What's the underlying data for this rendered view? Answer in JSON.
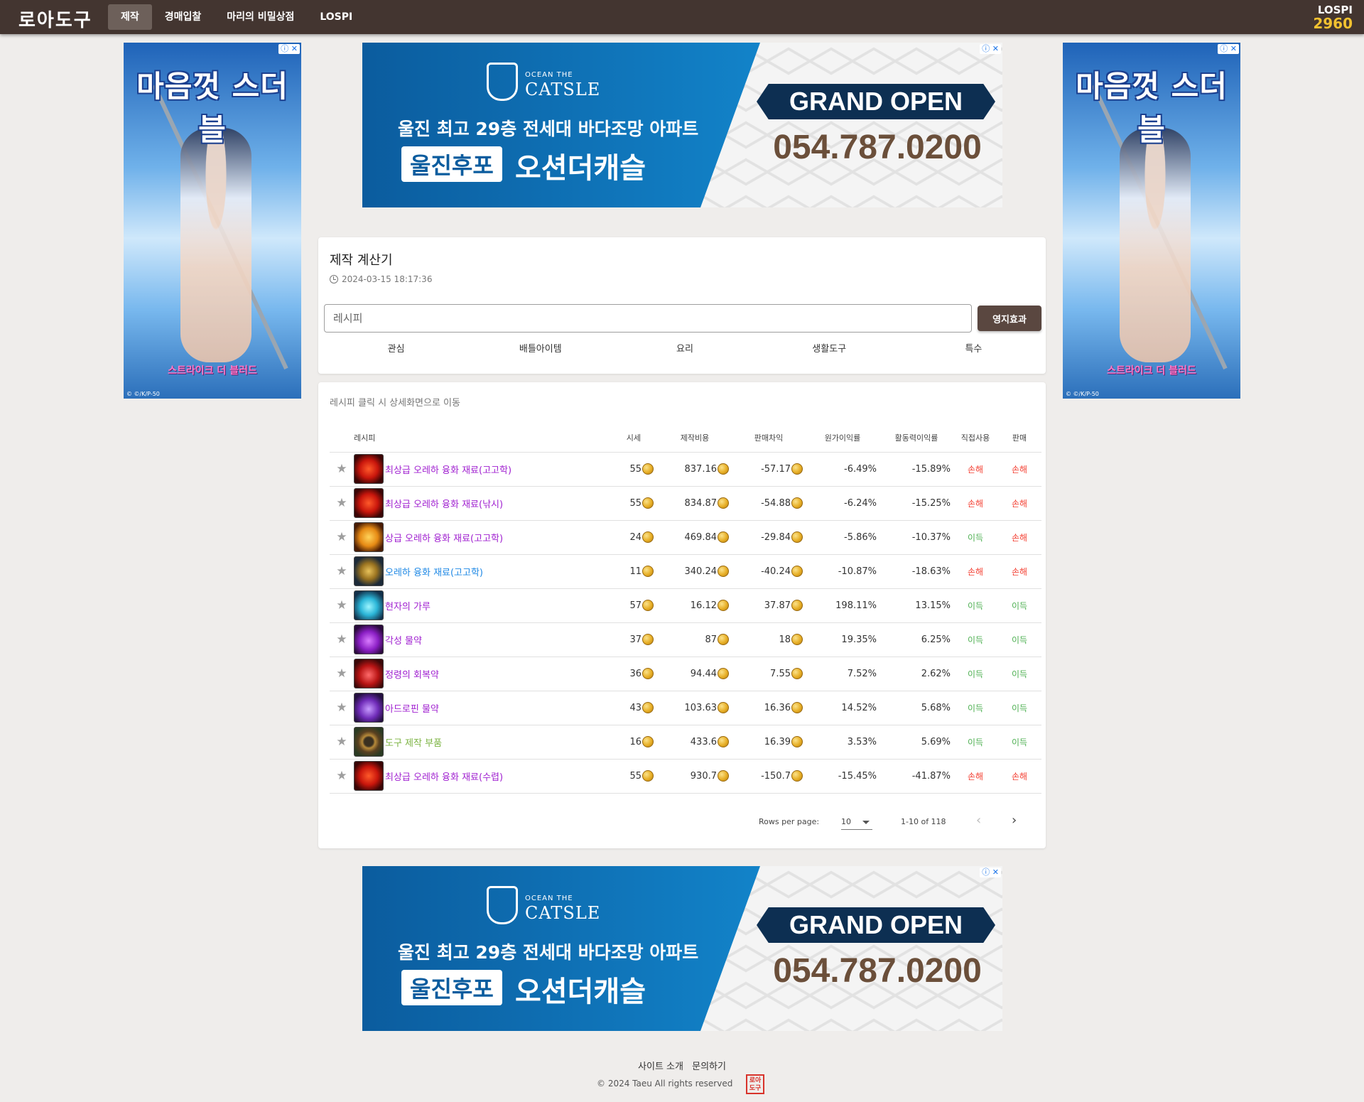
{
  "header": {
    "logo": "로아도구",
    "nav": [
      "제작",
      "경매입찰",
      "마리의 비밀상점",
      "LOSPI"
    ],
    "lospi_label": "LOSPI",
    "lospi_value": "2960"
  },
  "ads": {
    "side_title": "마음껏 스더블",
    "side_sub": "스트라이크 더 블러드",
    "side_copy": "© ©/K/P-50",
    "banner": {
      "brand_small": "OCEAN THE",
      "brand_big": "CATSLE",
      "line1": "울진 최고 29층 전세대 바다조망 아파트",
      "tag": "울진후포",
      "name": "오션더캐슬",
      "open": "GRAND OPEN",
      "phone": "054.787.0200"
    },
    "close_label": "ⓘ ✕"
  },
  "calculator": {
    "title": "제작 계산기",
    "timestamp": "2024-03-15 18:17:36",
    "search_placeholder": "레시피",
    "territory_button": "영지효과",
    "categories": [
      "관심",
      "배틀아이템",
      "요리",
      "생활도구",
      "특수"
    ]
  },
  "recipes": {
    "hint": "레시피 클릭 시 상세화면으로 이동",
    "columns": [
      "레시피",
      "시세",
      "제작비용",
      "판매차익",
      "원가이익률",
      "활동력이익률",
      "직접사용",
      "판매"
    ],
    "colors": {
      "profit": "#4caf50",
      "loss": "#f44336",
      "purple": "#a020d0",
      "blue": "#1e88e5",
      "green": "#7cb342"
    },
    "rows": [
      {
        "name": "최상급 오레하 융화 재료(고고학)",
        "name_color": "#a020d0",
        "icon": "red-gem-icon",
        "price": "55",
        "cost": "837.16",
        "margin": "-57.17",
        "cost_rate": "-6.49%",
        "energy_rate": "-15.89%",
        "direct": "손해",
        "sell": "손해"
      },
      {
        "name": "최상급 오레하 융화 재료(낚시)",
        "name_color": "#a020d0",
        "icon": "red-gem-icon",
        "price": "55",
        "cost": "834.87",
        "margin": "-54.88",
        "cost_rate": "-6.24%",
        "energy_rate": "-15.25%",
        "direct": "손해",
        "sell": "손해"
      },
      {
        "name": "상급 오레하 융화 재료(고고학)",
        "name_color": "#a020d0",
        "icon": "orange-gem-icon",
        "price": "24",
        "cost": "469.84",
        "margin": "-29.84",
        "cost_rate": "-5.86%",
        "energy_rate": "-10.37%",
        "direct": "이득",
        "sell": "손해"
      },
      {
        "name": "오레하 융화 재료(고고학)",
        "name_color": "#1e88e5",
        "icon": "gold-ore-icon",
        "price": "11",
        "cost": "340.24",
        "margin": "-40.24",
        "cost_rate": "-10.87%",
        "energy_rate": "-18.63%",
        "direct": "손해",
        "sell": "손해"
      },
      {
        "name": "현자의 가루",
        "name_color": "#a020d0",
        "icon": "crystal-powder-icon",
        "price": "57",
        "cost": "16.12",
        "margin": "37.87",
        "cost_rate": "198.11%",
        "energy_rate": "13.15%",
        "direct": "이득",
        "sell": "이득"
      },
      {
        "name": "각성 물약",
        "name_color": "#a020d0",
        "icon": "purple-potion-icon",
        "price": "37",
        "cost": "87",
        "margin": "18",
        "cost_rate": "19.35%",
        "energy_rate": "6.25%",
        "direct": "이득",
        "sell": "이득"
      },
      {
        "name": "정령의 회복약",
        "name_color": "#a020d0",
        "icon": "red-potion-icon",
        "price": "36",
        "cost": "94.44",
        "margin": "7.55",
        "cost_rate": "7.52%",
        "energy_rate": "2.62%",
        "direct": "이득",
        "sell": "이득"
      },
      {
        "name": "아드로핀 물약",
        "name_color": "#a020d0",
        "icon": "violet-vial-icon",
        "price": "43",
        "cost": "103.63",
        "margin": "16.36",
        "cost_rate": "14.52%",
        "energy_rate": "5.68%",
        "direct": "이득",
        "sell": "이득"
      },
      {
        "name": "도구 제작 부품",
        "name_color": "#7cb342",
        "icon": "gear-ring-icon",
        "price": "16",
        "cost": "433.6",
        "margin": "16.39",
        "cost_rate": "3.53%",
        "energy_rate": "5.69%",
        "direct": "이득",
        "sell": "이득"
      },
      {
        "name": "최상급 오레하 융화 재료(수렵)",
        "name_color": "#a020d0",
        "icon": "red-gem-icon",
        "price": "55",
        "cost": "930.7",
        "margin": "-150.7",
        "cost_rate": "-15.45%",
        "energy_rate": "-41.87%",
        "direct": "손해",
        "sell": "손해"
      }
    ],
    "pagination": {
      "rows_per_page_label": "Rows per page:",
      "rows_per_page": "10",
      "range": "1-10 of 118",
      "prev": "‹",
      "next": "›"
    }
  },
  "footer": {
    "links": [
      "사이트 소개",
      "문의하기"
    ],
    "copyright": "© 2024 Taeu All rights reserved",
    "seal": "로아도구"
  }
}
